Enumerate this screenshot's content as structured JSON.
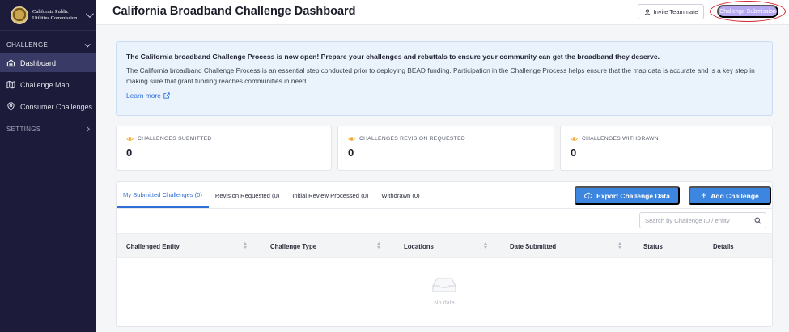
{
  "brand": {
    "name": "California Public Utilities Commission"
  },
  "sidebar": {
    "challenge_section": "CHALLENGE",
    "items": [
      {
        "label": "Dashboard",
        "icon": "home-icon"
      },
      {
        "label": "Challenge Map",
        "icon": "map-icon"
      },
      {
        "label": "Consumer Challenges",
        "icon": "location-pin-icon"
      }
    ],
    "settings_section": "SETTINGS"
  },
  "header": {
    "title": "California Broadband Challenge Dashboard",
    "invite_label": "Invite Teammate",
    "submission_label": "Challenge Submission"
  },
  "banner": {
    "title": "The California broadband Challenge Process is now open! Prepare your challenges and rebuttals to ensure your community can get the broadband they deserve.",
    "body": "The California broadband Challenge Process is an essential step conducted prior to deploying BEAD funding. Participation in the Challenge Process helps ensure that the map data is accurate and is a key step in making sure that grant funding reaches communities in need.",
    "link": "Learn more"
  },
  "stats": [
    {
      "label": "CHALLENGES SUBMITTED",
      "value": "0"
    },
    {
      "label": "CHALLENGES REVISION REQUESTED",
      "value": "0"
    },
    {
      "label": "CHALLENGES WITHDRAWN",
      "value": "0"
    }
  ],
  "tabs": [
    "My Submitted Challenges (0)",
    "Revision Requested (0)",
    "Initial Review Processed (0)",
    "Withdrawn (0)"
  ],
  "actions": {
    "export": "Export Challenge Data",
    "add": "Add Challenge"
  },
  "search": {
    "placeholder": "Search by Challenge ID / entity"
  },
  "table": {
    "columns": [
      "Challenged Entity",
      "Challenge Type",
      "Locations",
      "Date Submitted",
      "Status",
      "Details"
    ],
    "empty_text": "No data"
  },
  "colors": {
    "sidebar": "#1c1c3a",
    "accent": "#3d86e0",
    "submission_button": "#b6a8f0",
    "highlight_ring": "#d2232a",
    "banner": "#eaf2fc",
    "stat_icon": "#f0a52a"
  }
}
